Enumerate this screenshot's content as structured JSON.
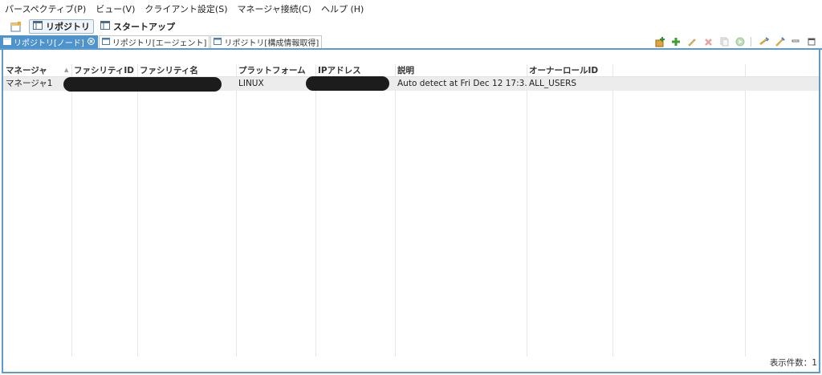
{
  "menu": [
    "パースペクティブ(P)",
    "ビュー(V)",
    "クライアント設定(S)",
    "マネージャ接続(C)",
    "ヘルプ (H)"
  ],
  "perspectives": [
    {
      "label": "リポジトリ",
      "active": true
    },
    {
      "label": "スタートアップ",
      "active": false
    }
  ],
  "tabs": [
    {
      "label": "リポジトリ[ノード]",
      "active": true
    },
    {
      "label": "リポジトリ[エージェント]",
      "active": false
    },
    {
      "label": "リポジトリ[構成情報取得]",
      "active": false
    }
  ],
  "table": {
    "columns": [
      "マネージャ",
      "ファシリティID",
      "ファシリティ名",
      "プラットフォーム",
      "IPアドレス",
      "説明",
      "オーナーロールID"
    ],
    "rows": [
      [
        "マネージャ1",
        "",
        "",
        "LINUX",
        "",
        "Auto detect at Fri Dec 12 17:3...",
        "ALL_USERS"
      ]
    ]
  },
  "footer": {
    "count_label": "表示件数：1"
  }
}
